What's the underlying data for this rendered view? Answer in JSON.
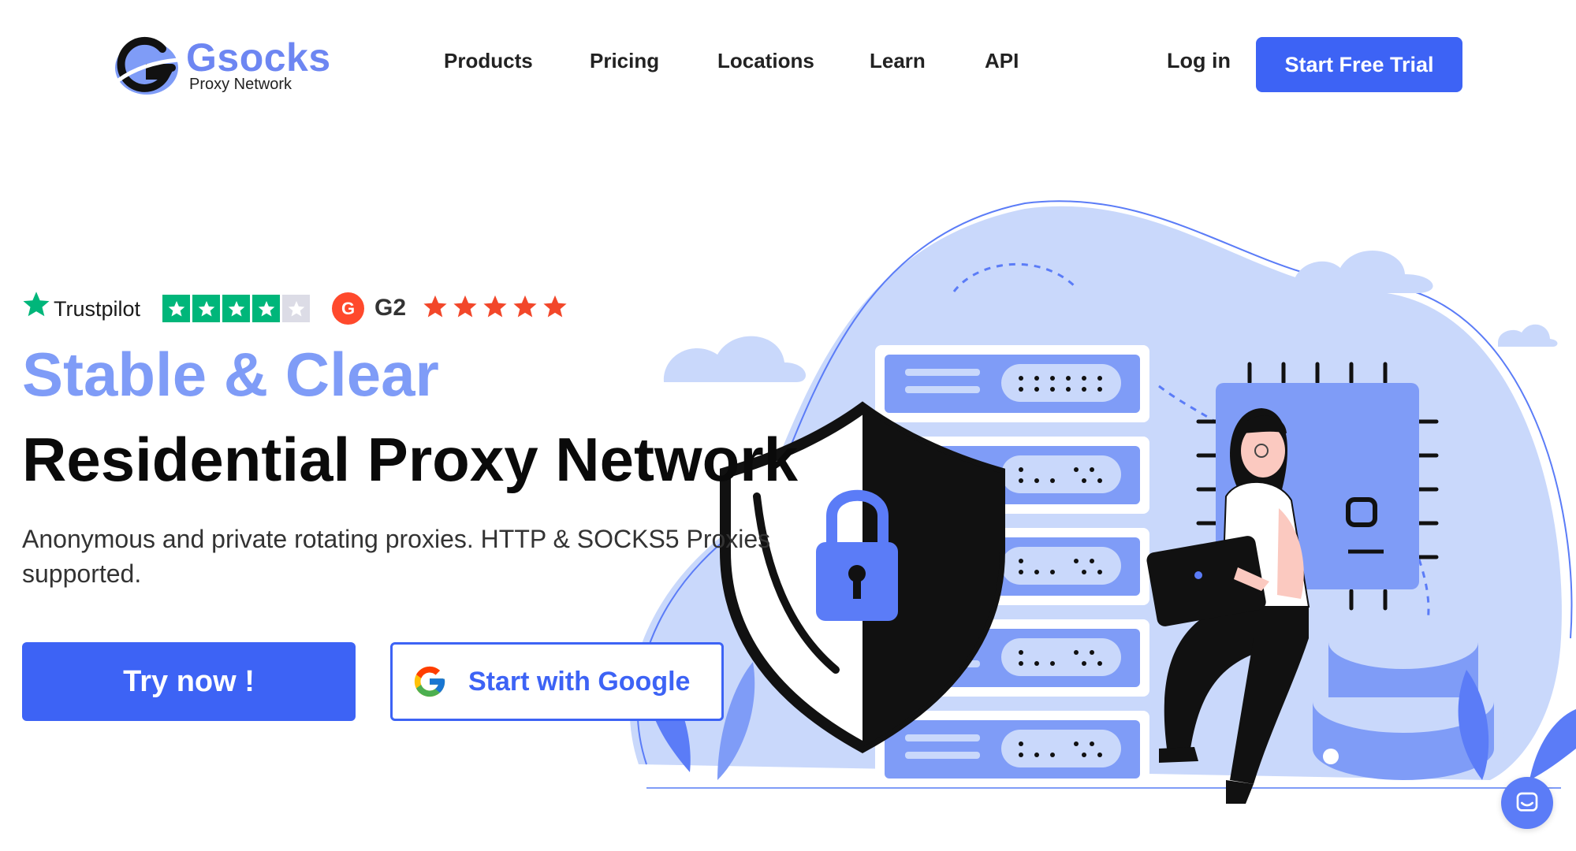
{
  "header": {
    "logo_name": "Gsocks",
    "logo_sub": "Proxy Network",
    "nav": [
      "Products",
      "Pricing",
      "Locations",
      "Learn",
      "API"
    ],
    "login": "Log in",
    "cta": "Start Free Trial"
  },
  "ratings": {
    "trustpilot_label": "Trustpilot",
    "trustpilot_stars": 4,
    "trustpilot_max": 5,
    "g2_label": "G2",
    "g2_stars": 5,
    "colors": {
      "trustpilot": "#00b67a",
      "g2": "#ff492c"
    }
  },
  "hero": {
    "title_accent": "Stable & Clear",
    "title_main": "Residential Proxy Network",
    "subtitle": "Anonymous and private rotating proxies. HTTP & SOCKS5 Proxies supported.",
    "try_button": "Try now !",
    "google_button": "Start with Google"
  },
  "icons": [
    "gsocks-logo-icon",
    "trustpilot-star-icon",
    "g2-logo-icon",
    "google-icon",
    "chat-icon"
  ],
  "colors": {
    "accent": "#3d63f5",
    "accent_light": "#7f9cf7",
    "illustration_bg": "#c9d8fb"
  }
}
